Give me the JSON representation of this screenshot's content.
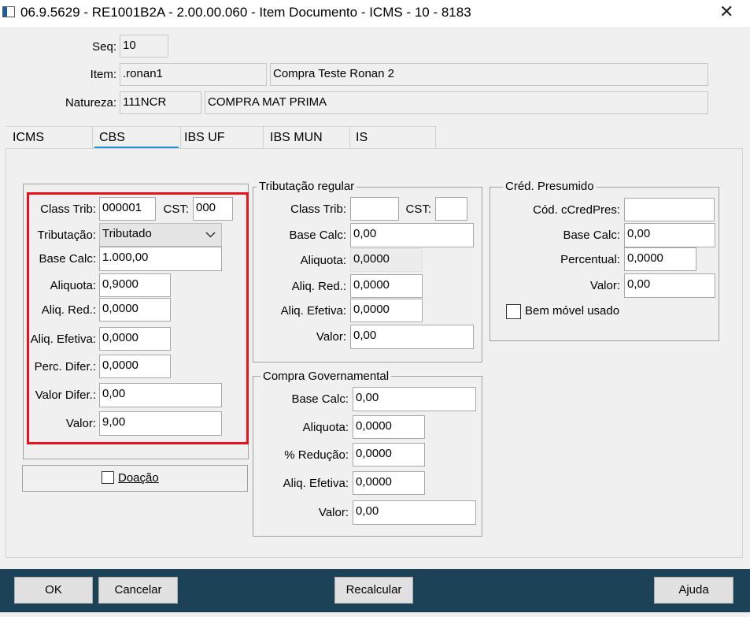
{
  "window": {
    "title": "06.9.5629 - RE1001B2A - 2.00.00.060 - Item Documento - ICMS - 10 - 8183",
    "close_glyph": "✕"
  },
  "header": {
    "seq_label": "Seq:",
    "seq_value": "10",
    "item_label": "Item:",
    "item_code": ".ronan1",
    "item_desc": "Compra Teste Ronan 2",
    "natureza_label": "Natureza:",
    "natureza_code": "111NCR",
    "natureza_desc": "COMPRA MAT PRIMA"
  },
  "tabs": [
    {
      "label": "ICMS"
    },
    {
      "label": "CBS",
      "active": true
    },
    {
      "label": "IBS UF"
    },
    {
      "label": "IBS MUN"
    },
    {
      "label": "IS"
    }
  ],
  "cbs_main": {
    "class_trib_label": "Class Trib:",
    "class_trib_value": "000001",
    "cst_label": "CST:",
    "cst_value": "000",
    "tributacao_label": "Tributação:",
    "tributacao_value": "Tributado",
    "base_calc_label": "Base Calc:",
    "base_calc_value": "1.000,00",
    "aliquota_label": "Aliquota:",
    "aliquota_value": "0,9000",
    "aliq_red_label": "Aliq. Red.:",
    "aliq_red_value": "0,0000",
    "aliq_efetiva_label": "Aliq. Efetiva:",
    "aliq_efetiva_value": "0,0000",
    "perc_difer_label": "Perc. Difer.:",
    "perc_difer_value": "0,0000",
    "valor_difer_label": "Valor Difer.:",
    "valor_difer_value": "0,00",
    "valor_label": "Valor:",
    "valor_value": "9,00",
    "doacao_label": "Doação"
  },
  "tributacao_regular": {
    "title": "Tributação regular",
    "class_trib_label": "Class Trib:",
    "class_trib_value": "",
    "cst_label": "CST:",
    "cst_value": "",
    "base_calc_label": "Base Calc:",
    "base_calc_value": "0,00",
    "aliquota_label": "Aliquota:",
    "aliquota_value": "0,0000",
    "aliq_red_label": "Aliq. Red.:",
    "aliq_red_value": "0,0000",
    "aliq_efetiva_label": "Aliq. Efetiva:",
    "aliq_efetiva_value": "0,0000",
    "valor_label": "Valor:",
    "valor_value": "0,00"
  },
  "compra_governamental": {
    "title": "Compra Governamental",
    "base_calc_label": "Base Calc:",
    "base_calc_value": "0,00",
    "aliquota_label": "Aliquota:",
    "aliquota_value": "0,0000",
    "reducao_label": "% Redução:",
    "reducao_value": "0,0000",
    "aliq_efetiva_label": "Aliq. Efetiva:",
    "aliq_efetiva_value": "0,0000",
    "valor_label": "Valor:",
    "valor_value": "0,00"
  },
  "cred_presumido": {
    "title": "Créd. Presumido",
    "cod_label": "Cód. cCredPres:",
    "cod_value": "",
    "base_calc_label": "Base Calc:",
    "base_calc_value": "0,00",
    "percentual_label": "Percentual:",
    "percentual_value": "0,0000",
    "valor_label": "Valor:",
    "valor_value": "0,00",
    "bem_movel_label": "Bem móvel usado"
  },
  "footer": {
    "ok": "OK",
    "cancelar": "Cancelar",
    "recalcular": "Recalcular",
    "ajuda": "Ajuda"
  },
  "colors": {
    "footer_bg": "#1c4257",
    "annotation_red": "#e8121b",
    "active_tab_underline": "#1e90d8"
  }
}
